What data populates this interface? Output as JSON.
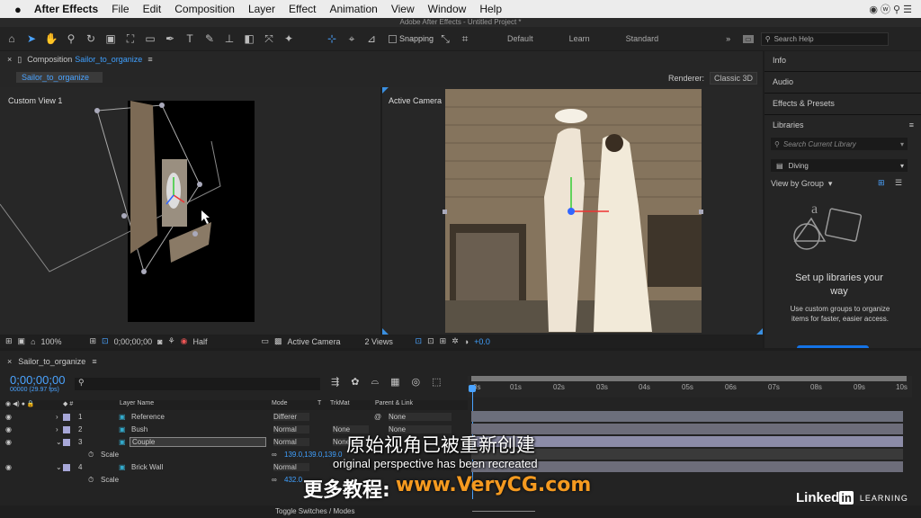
{
  "menu": {
    "apple": "",
    "app": "After Effects",
    "file": "File",
    "edit": "Edit",
    "composition": "Composition",
    "layer": "Layer",
    "effect": "Effect",
    "animation": "Animation",
    "view": "View",
    "window": "Window",
    "help": "Help",
    "wifi": "wifi-icon",
    "status_icons": "◉ ⓦ ⚲ ☰"
  },
  "window_title": "Adobe After Effects - Untitled Project *",
  "toolbar": {
    "snapping": "Snapping",
    "workspaces": [
      "Default",
      "Learn",
      "Standard"
    ],
    "search_placeholder": "Search Help"
  },
  "comp": {
    "tab_prefix": "Composition",
    "tab_name": "Sailor_to_organize",
    "breadcrumb": "Sailor_to_organize",
    "renderer_label": "Renderer:",
    "renderer_value": "Classic 3D",
    "left_view_label": "Custom View 1",
    "right_view_label": "Active Camera"
  },
  "viewer_footer": {
    "zoom": "100%",
    "timecode": "0;00;00;00",
    "resolution": "Half",
    "camera": "Active Camera",
    "views": "2 Views",
    "exposure": "+0.0"
  },
  "right_panel": {
    "info": "Info",
    "audio": "Audio",
    "effects_presets": "Effects & Presets",
    "libraries": "Libraries",
    "search_library": "Search Current Library",
    "library_name": "Diving",
    "view_by": "View by Group",
    "setup_title": "Set up libraries your way",
    "setup_body": "Use custom groups to organize items for faster, easier access."
  },
  "timeline": {
    "tab_name": "Sailor_to_organize",
    "timecode": "0;00;00;00",
    "fps": "00000 (29.97 fps)",
    "col_layer_name": "Layer Name",
    "col_mode": "Mode",
    "col_t": "T",
    "col_trkmat": "TrkMat",
    "col_parent": "Parent & Link",
    "ruler": [
      "0s",
      "01s",
      "02s",
      "03s",
      "04s",
      "05s",
      "06s",
      "07s",
      "08s",
      "09s",
      "10s"
    ],
    "toggle": "Toggle Switches / Modes",
    "layers": [
      {
        "num": "1",
        "name": "Reference",
        "mode": "Differer",
        "parent": "None"
      },
      {
        "num": "2",
        "name": "Bush",
        "mode": "Normal",
        "trkmat": "None",
        "parent": "None"
      },
      {
        "num": "3",
        "name": "Couple",
        "mode": "Normal",
        "trkmat": "None"
      },
      {
        "num": "4",
        "name": "Brick Wall",
        "mode": "Normal"
      }
    ],
    "scale_label": "Scale",
    "scale_value_3": "139.0,139.0,139.0",
    "scale_value_4": "432.0"
  },
  "subtitles": {
    "chinese": "原始视角已被重新创建",
    "english": "original perspective has been recreated",
    "watermark_prefix": "更多教程:",
    "watermark_url": "www.VeryCG.com"
  },
  "brand": {
    "linkedin": "Linked",
    "in": "in",
    "learning": "LEARNING"
  }
}
